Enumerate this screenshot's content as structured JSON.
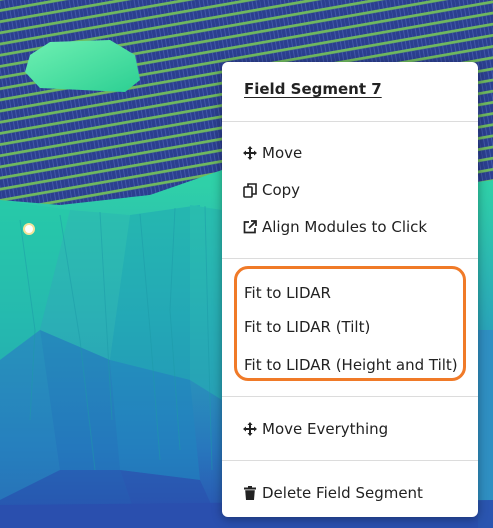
{
  "context_menu": {
    "title": "Field Segment 7",
    "items": {
      "move": "Move",
      "copy": "Copy",
      "align": "Align Modules to Click",
      "fit_lidar": "Fit to LIDAR",
      "fit_lidar_tilt": "Fit to LIDAR (Tilt)",
      "fit_lidar_height_tilt": "Fit to LIDAR (Height and Tilt)",
      "move_everything": "Move Everything",
      "delete": "Delete Field Segment"
    },
    "icons": {
      "move": "move-arrows-icon",
      "copy": "copy-icon",
      "align": "external-link-icon",
      "move_everything": "move-arrows-icon",
      "delete": "trash-icon"
    },
    "highlight_color": "#f07a28"
  },
  "scene": {
    "terrain_colors": [
      "#2ad6a0",
      "#34b7b6",
      "#2c8fc1",
      "#2a57b0"
    ],
    "module_color": "#2b3f8f",
    "module_gap_color": "#7ec06a"
  }
}
